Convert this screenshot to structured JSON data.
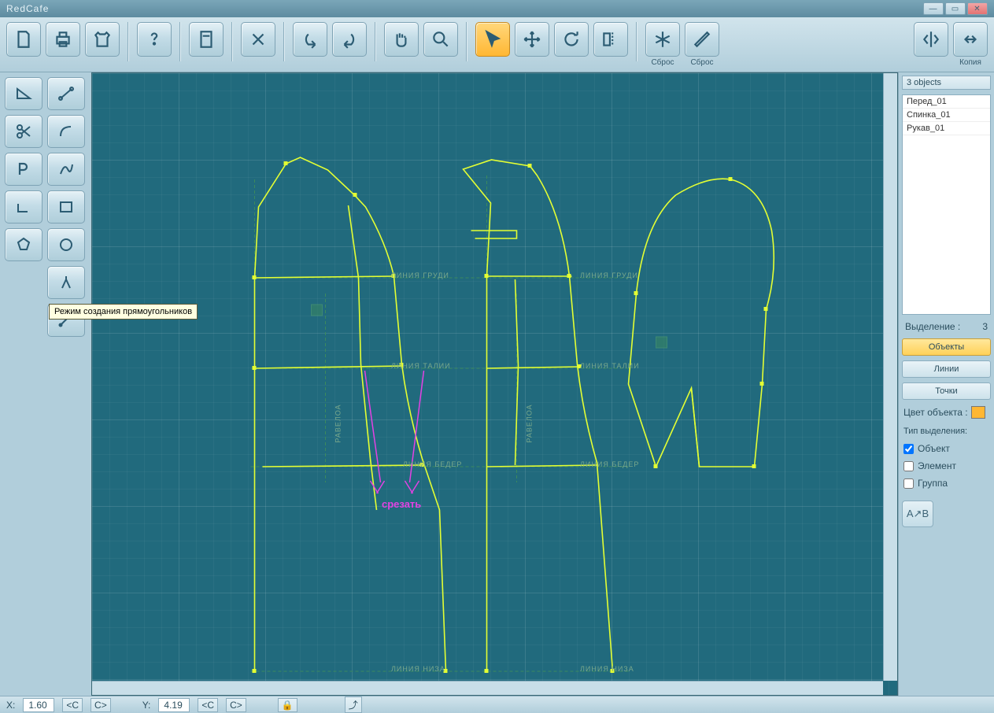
{
  "app_title": "RedCafe",
  "toolbar": {
    "reset1": "Сброс",
    "reset2": "Сброс",
    "copy": "Копия"
  },
  "tooltip_rect": "Режим создания прямоугольников",
  "right": {
    "count_label": "3 objects",
    "objects": [
      "Перед_01",
      "Спинка_01",
      "Рукав_01"
    ],
    "selection_label": "Выделение :",
    "selection_count": "3",
    "buttons": {
      "objects": "Объекты",
      "lines": "Линии",
      "points": "Точки"
    },
    "color_label": "Цвет объекта :",
    "sel_type_label": "Тип выделения:",
    "checks": {
      "object": "Объект",
      "element": "Элемент",
      "group": "Группа"
    }
  },
  "canvas_labels": {
    "chest": "ЛИНИЯ ГРУДИ",
    "waist": "ЛИНИЯ ТАЛИИ",
    "hip": "ЛИНИЯ БЕДЕР",
    "bottom": "ЛИНИЯ НИЗА",
    "balance": "РАВЕЛОА"
  },
  "canvas_text": {
    "cut": "срезать"
  },
  "status": {
    "x_label": "X:",
    "x_val": "1.60",
    "y_label": "Y:",
    "y_val": "4.19",
    "c_lt": "<C",
    "c_gt": "C>"
  }
}
